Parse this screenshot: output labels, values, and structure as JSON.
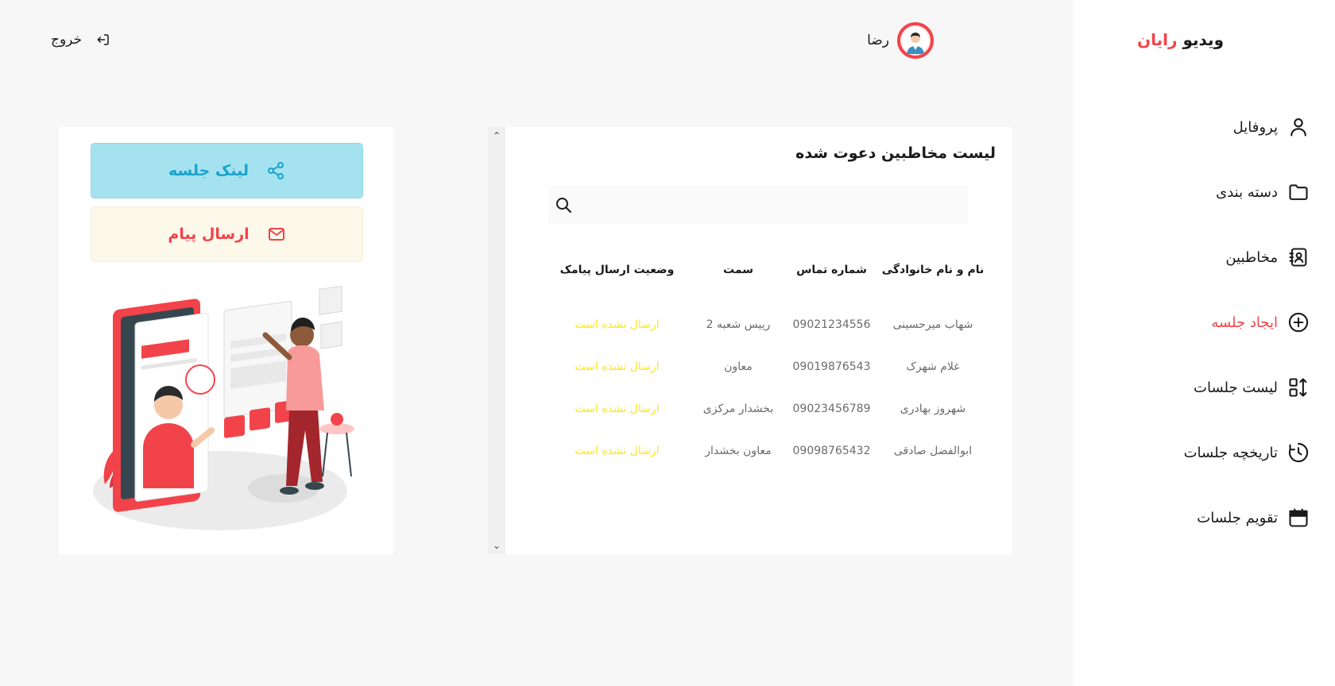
{
  "brand": {
    "part1": "ویدیو",
    "part2": "رایان"
  },
  "nav": [
    {
      "label": "پروفایل",
      "icon": "user-icon"
    },
    {
      "label": "دسته بندی",
      "icon": "folder-icon"
    },
    {
      "label": "مخاطبین",
      "icon": "contacts-icon"
    },
    {
      "label": "ایجاد جلسه",
      "icon": "plus-circle-icon",
      "active": true
    },
    {
      "label": "لیست جلسات",
      "icon": "sort-list-icon"
    },
    {
      "label": "تاریخچه جلسات",
      "icon": "history-icon"
    },
    {
      "label": "تقویم جلسات",
      "icon": "calendar-icon"
    }
  ],
  "user": {
    "name": "رضا"
  },
  "logout": {
    "label": "خروج"
  },
  "contacts": {
    "title": "لیست مخاطبین دعوت شده",
    "search_placeholder": "",
    "columns": [
      "نام و نام خانوادگی",
      "شماره تماس",
      "سمت",
      "وضعیت ارسال پیامک"
    ],
    "rows": [
      {
        "name": "شهاب میرحسینی",
        "phone": "09021234556",
        "role": "رییس شعبه 2",
        "status": "ارسال نشده است"
      },
      {
        "name": "غلام شهرک",
        "phone": "09019876543",
        "role": "معاون",
        "status": "ارسال نشده است"
      },
      {
        "name": "شهروز بهادری",
        "phone": "09023456789",
        "role": "بخشدار مرکزی",
        "status": "ارسال نشده است"
      },
      {
        "name": "ابوالفضل صادقی",
        "phone": "09098765432",
        "role": "معاون بخشدار",
        "status": "ارسال نشده است"
      }
    ]
  },
  "actions": {
    "link_label": "لینک جلسه",
    "message_label": "ارسال پیام"
  },
  "colors": {
    "accent": "#f2434a",
    "link_bg": "#a5e2f0",
    "link_text": "#1aa3cc",
    "status": "#ffe619"
  }
}
